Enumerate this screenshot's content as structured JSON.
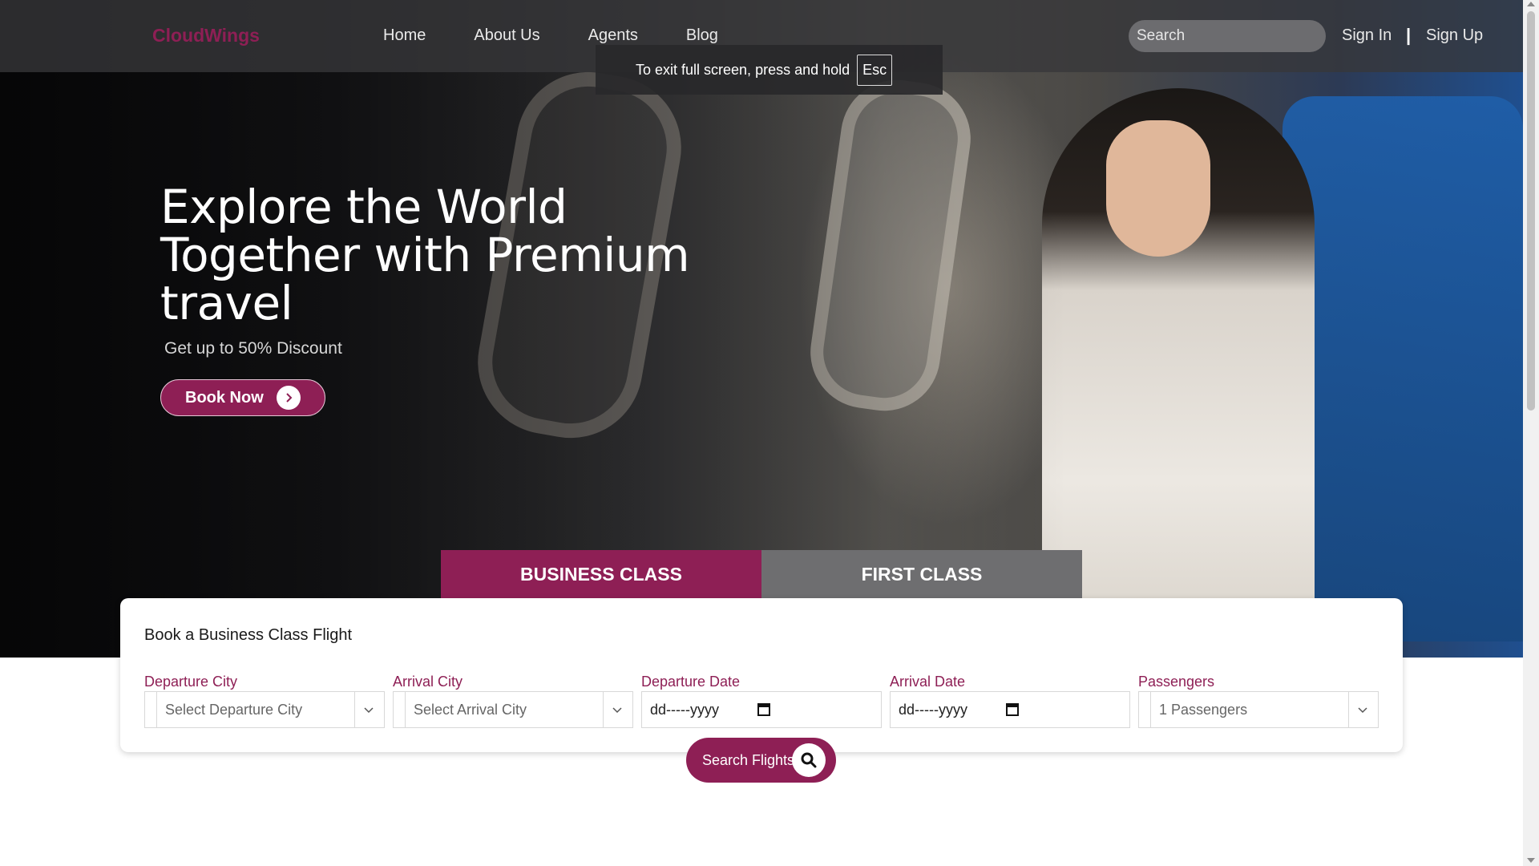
{
  "nav": {
    "logo": "CloudWings",
    "links": [
      "Home",
      "About Us",
      "Agents",
      "Blog"
    ],
    "search_placeholder": "Search",
    "sign_in": "Sign In",
    "divider": "|",
    "sign_up": "Sign Up"
  },
  "fullscreen_notice": {
    "text": "To exit full screen, press and hold",
    "key": "Esc"
  },
  "hero": {
    "title": "Explore the World Together with Premium travel",
    "subtitle": "Get up to 50% Discount",
    "cta": "Book Now"
  },
  "tabs": {
    "business": "BUSINESS CLASS",
    "first": "FIRST CLASS",
    "active": "business"
  },
  "booking": {
    "title": "Book a Business Class Flight",
    "departure_city": {
      "label": "Departure City",
      "value": "Select Departure City"
    },
    "arrival_city": {
      "label": "Arrival City",
      "value": "Select Arrival City"
    },
    "departure_date": {
      "label": "Departure Date",
      "value": "dd-----yyyy"
    },
    "arrival_date": {
      "label": "Arrival Date",
      "value": "dd-----yyyy"
    },
    "passengers": {
      "label": "Passengers",
      "value": "1 Passengers"
    },
    "search_button": "Search Flights"
  },
  "colors": {
    "brand": "#8e1f55",
    "tab_inactive": "#6e6e70"
  },
  "icons": {
    "book_now": "chevron-right-icon",
    "search_flights": "search-icon",
    "select": "chevron-down-icon",
    "date": "calendar-icon"
  }
}
